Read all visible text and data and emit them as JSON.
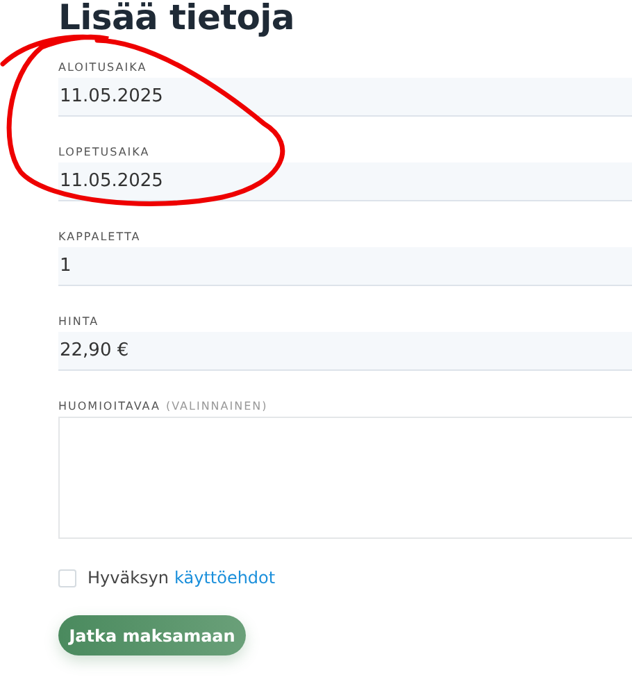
{
  "title": "Lisää tietoja",
  "fields": [
    {
      "kind": "input",
      "label": "ALOITUSAIKA",
      "value": "11.05.2025"
    },
    {
      "kind": "input",
      "label": "LOPETUSAIKA",
      "value": "11.05.2025"
    },
    {
      "kind": "input",
      "label": "KAPPALETTA",
      "value": "1"
    },
    {
      "kind": "input",
      "label": "HINTA",
      "value": "22,90 €"
    },
    {
      "kind": "textarea",
      "label": "HUOMIOITAVAA",
      "hint": "(VALINNAINEN)"
    }
  ],
  "terms": {
    "checked": false,
    "text": "Hyväksyn",
    "link": "käyttöehdot"
  },
  "button": "Jatka maksamaan"
}
